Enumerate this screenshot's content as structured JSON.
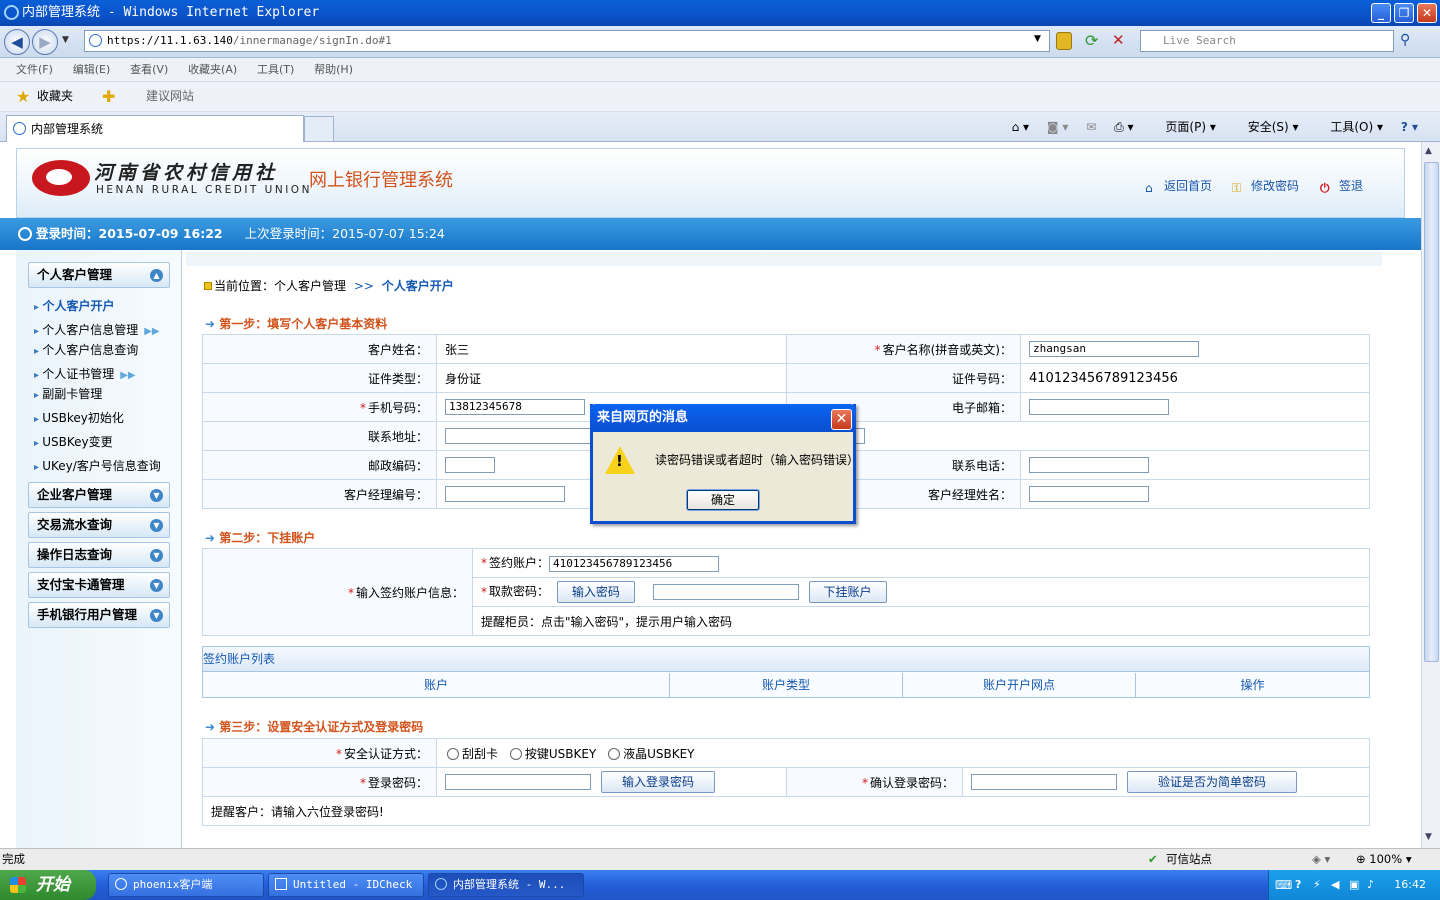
{
  "window": {
    "title": "内部管理系统 - Windows Internet Explorer"
  },
  "browser": {
    "url_prefix": "https://11.1.63.140",
    "url_path": "/innermanage/signIn.do#1",
    "search_placeholder": "Live Search",
    "menu": [
      "文件(F)",
      "编辑(E)",
      "查看(V)",
      "收藏夹(A)",
      "工具(T)",
      "帮助(H)"
    ],
    "favorites": "收藏夹",
    "suggested_sites": "建议网站",
    "tab_title": "内部管理系统",
    "cmd": {
      "page": "页面(P)",
      "safety": "安全(S)",
      "tools": "工具(O)"
    }
  },
  "header": {
    "logo_cn": "河南省农村信用社",
    "logo_en": "HENAN RURAL CREDIT UNION",
    "system_title": "网上银行管理系统",
    "home_link": "返回首页",
    "password_link": "修改密码",
    "logout_link": "签退"
  },
  "login": {
    "current_label": "登录时间：",
    "current_time": "2015-07-09 16:22",
    "last_label": "上次登录时间：",
    "last_time": "2015-07-07 15:24"
  },
  "sidebar": {
    "personal_header": "个人客户管理",
    "sub": [
      "个人客户开户",
      "个人客户信息管理",
      "个人客户信息查询",
      "个人证书管理",
      "副副卡管理",
      "USBkey初始化",
      "USBKey变更",
      "UKey/客户号信息查询"
    ],
    "groups": [
      "企业客户管理",
      "交易流水查询",
      "操作日志查询",
      "支付宝卡通管理",
      "手机银行用户管理"
    ]
  },
  "breadcrumb": {
    "prefix": "当前位置：个人客户管理",
    "sep": ">>",
    "current": "个人客户开户"
  },
  "step1": {
    "title": "第一步：填写个人客户基本资料",
    "name_label": "客户姓名：",
    "name_value": "张三",
    "en_name_label": "客户名称(拼音或英文)：",
    "en_name_value": "zhangsan",
    "id_type_label": "证件类型：",
    "id_type_value": "身份证",
    "id_no_label": "证件号码：",
    "id_no_value": "410123456789123456",
    "mobile_label": "手机号码：",
    "mobile_value": "13812345678",
    "email_label": "电子邮箱：",
    "address_label": "联系地址：",
    "zip_label": "邮政编码：",
    "phone_label": "联系电话：",
    "mgr_no_label": "客户经理编号：",
    "mgr_name_label": "客户经理姓名："
  },
  "step2": {
    "title": "第二步：下挂账户",
    "sign_info_label": "输入签约账户信息：",
    "account_label": "签约账户：",
    "account_value": "410123456789123456",
    "pwd_label": "取款密码：",
    "enter_pwd_btn": "输入密码",
    "attach_btn": "下挂账户",
    "hint": "提醒柜员：点击\"输入密码\"，提示用户输入密码"
  },
  "list": {
    "title": "签约账户列表",
    "columns": [
      "账户",
      "账户类型",
      "账户开户网点",
      "操作"
    ]
  },
  "step3": {
    "title": "第三步：设置安全认证方式及登录密码",
    "auth_label": "安全认证方式：",
    "options": [
      "刮刮卡",
      "按键USBKEY",
      "液晶USBKEY"
    ],
    "login_pwd_label": "登录密码：",
    "login_pwd_btn": "输入登录密码",
    "confirm_pwd_label": "确认登录密码：",
    "verify_btn": "验证是否为简单密码",
    "hint": "提醒客户：请输入六位登录密码!"
  },
  "dialog": {
    "title": "来自网页的消息",
    "message": "读密码错误或者超时（输入密码错误）",
    "ok": "确定"
  },
  "statusbar": {
    "left": "完成",
    "zone": "可信站点",
    "zoom": "100%"
  },
  "taskbar": {
    "start": "开始",
    "tasks": [
      "phoenix客户端",
      "Untitled - IDCheck",
      "内部管理系统 - W..."
    ],
    "clock": "16:42"
  }
}
